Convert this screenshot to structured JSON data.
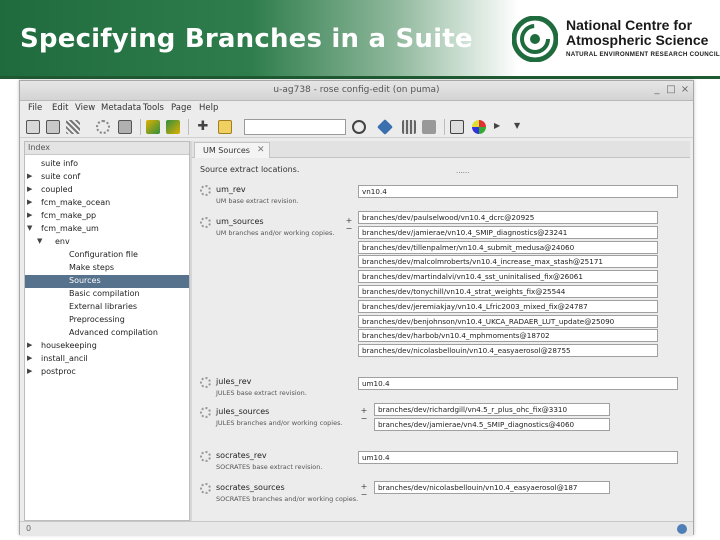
{
  "slide": {
    "title": "Specifying Branches in a Suite",
    "logo_name_line1": "National Centre for",
    "logo_name_line2": "Atmospheric Science",
    "logo_sub": "NATURAL ENVIRONMENT RESEARCH COUNCIL",
    "header_color": "#1f6b3e"
  },
  "window": {
    "title": "u-ag738 - rose config-edit (on puma)",
    "controls": [
      "_",
      "□",
      "×"
    ]
  },
  "menu": [
    "File",
    "Edit",
    "View",
    "Metadata",
    "Tools",
    "Page",
    "Help"
  ],
  "toolbar_icons": [
    "open-icon",
    "save-icon",
    "checker-icon",
    "gear-icon",
    "folder-icon",
    "undo-icon",
    "redo-icon",
    "add-icon",
    "find-icon",
    "search-icon",
    "info-icon",
    "tools-icon",
    "stack-icon",
    "graph-icon",
    "run-icon"
  ],
  "tree": {
    "header": "Index",
    "items": [
      {
        "label": "suite info",
        "arrow": ""
      },
      {
        "label": "suite conf",
        "arrow": "▶"
      },
      {
        "label": "coupled",
        "arrow": "▶"
      },
      {
        "label": "fcm_make_ocean",
        "arrow": "▶"
      },
      {
        "label": "fcm_make_pp",
        "arrow": "▶"
      },
      {
        "label": "fcm_make_um",
        "arrow": "▼"
      },
      {
        "label": "env",
        "arrow": "▼"
      },
      {
        "label": "Configuration file",
        "arrow": ""
      },
      {
        "label": "Make steps",
        "arrow": ""
      },
      {
        "label": "Sources",
        "arrow": ""
      },
      {
        "label": "Basic compilation",
        "arrow": ""
      },
      {
        "label": "External libraries",
        "arrow": ""
      },
      {
        "label": "Preprocessing",
        "arrow": ""
      },
      {
        "label": "Advanced compilation",
        "arrow": ""
      },
      {
        "label": "housekeeping",
        "arrow": "▶"
      },
      {
        "label": "install_ancil",
        "arrow": "▶"
      },
      {
        "label": "postproc",
        "arrow": "▶"
      }
    ],
    "selected": "Sources"
  },
  "tab": {
    "label": "UM Sources",
    "close": "✕"
  },
  "content": {
    "intro": "Source extract locations.",
    "dots": "......",
    "um_rev": {
      "name": "um_rev",
      "desc": "UM base extract revision.",
      "value": "vn10.4"
    },
    "um_sources": {
      "name": "um_sources",
      "desc": "UM branches and/or working copies.",
      "values": [
        "branches/dev/paulselwood/vn10.4_dcrc@20925",
        "branches/dev/jamierae/vn10.4_SMIP_diagnostics@23241",
        "branches/dev/tillenpalmer/vn10.4_submit_medusa@24060",
        "branches/dev/malcolmroberts/vn10.4_increase_max_stash@25171",
        "branches/dev/martindalvi/vn10.4_sst_uninitalised_fix@26061",
        "branches/dev/tonychill/vn10.4_strat_weights_fix@25544",
        "branches/dev/jeremiakjay/vn10.4_Lfric2003_mixed_fix@24787",
        "branches/dev/benjohnson/vn10.4_UKCA_RADAER_LUT_update@25090",
        "branches/dev/harbob/vn10.4_mphmoments@18702",
        "branches/dev/nicolasbellouin/vn10.4_easyaerosol@28755"
      ]
    },
    "jules_rev": {
      "name": "jules_rev",
      "desc": "JULES base extract revision.",
      "value": "um10.4"
    },
    "jules_sources": {
      "name": "jules_sources",
      "desc": "JULES branches and/or working copies.",
      "values": [
        "branches/dev/richardgill/vn4.5_r_plus_ohc_fix@3310",
        "branches/dev/jamierae/vn4.5_SMIP_diagnostics@4060"
      ]
    },
    "socrates_rev": {
      "name": "socrates_rev",
      "desc": "SOCRATES base extract revision.",
      "value": "um10.4"
    },
    "socrates_sources": {
      "name": "socrates_sources",
      "desc": "SOCRATES branches and/or working copies.",
      "values": [
        "branches/dev/nicolasbellouin/vn10.4_easyaerosol@187"
      ]
    }
  },
  "status": {
    "left": "0"
  }
}
